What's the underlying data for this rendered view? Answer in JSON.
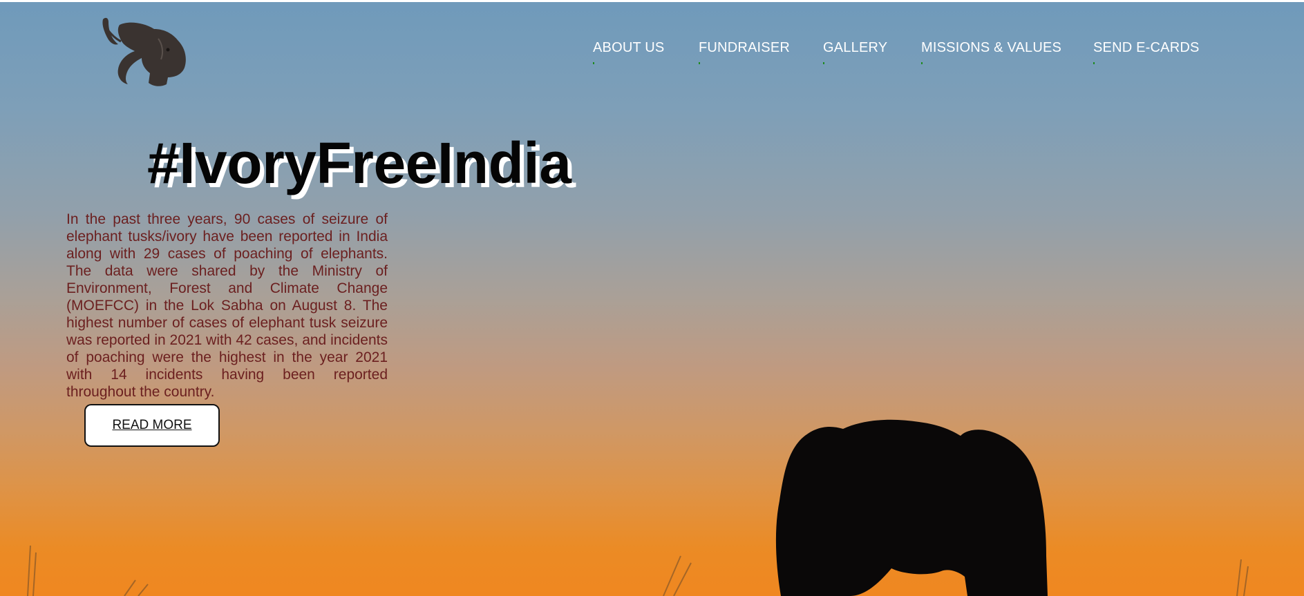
{
  "nav": {
    "items": [
      {
        "label": "ABOUT US"
      },
      {
        "label": "FUNDRAISER"
      },
      {
        "label": "GALLERY"
      },
      {
        "label": "MISSIONS & VALUES"
      },
      {
        "label": "SEND E-CARDS"
      }
    ]
  },
  "hero": {
    "title": "#IvoryFreeIndia",
    "body": "In the past three years, 90 cases of seizure of elephant tusks/ivory have been reported in India along with 29 cases of poaching of elephants. The data were shared by the Ministry of Environment, Forest and Climate Change (MOEFCC) in the Lok Sabha on August 8. The highest number of cases of elephant tusk seizure was reported in 2021 with 42 cases, and incidents of poaching were the highest in the year 2021 with 14 incidents having been reported throughout the country.",
    "cta_label": "READ MORE"
  },
  "icons": {
    "logo": "elephant-head-logo"
  },
  "colors": {
    "sky_top": "#6f9abb",
    "sky_bottom": "#f08720",
    "body_text": "#6b1f1f",
    "nav_text": "#ffffff",
    "nav_tick": "#1f8a1f"
  }
}
